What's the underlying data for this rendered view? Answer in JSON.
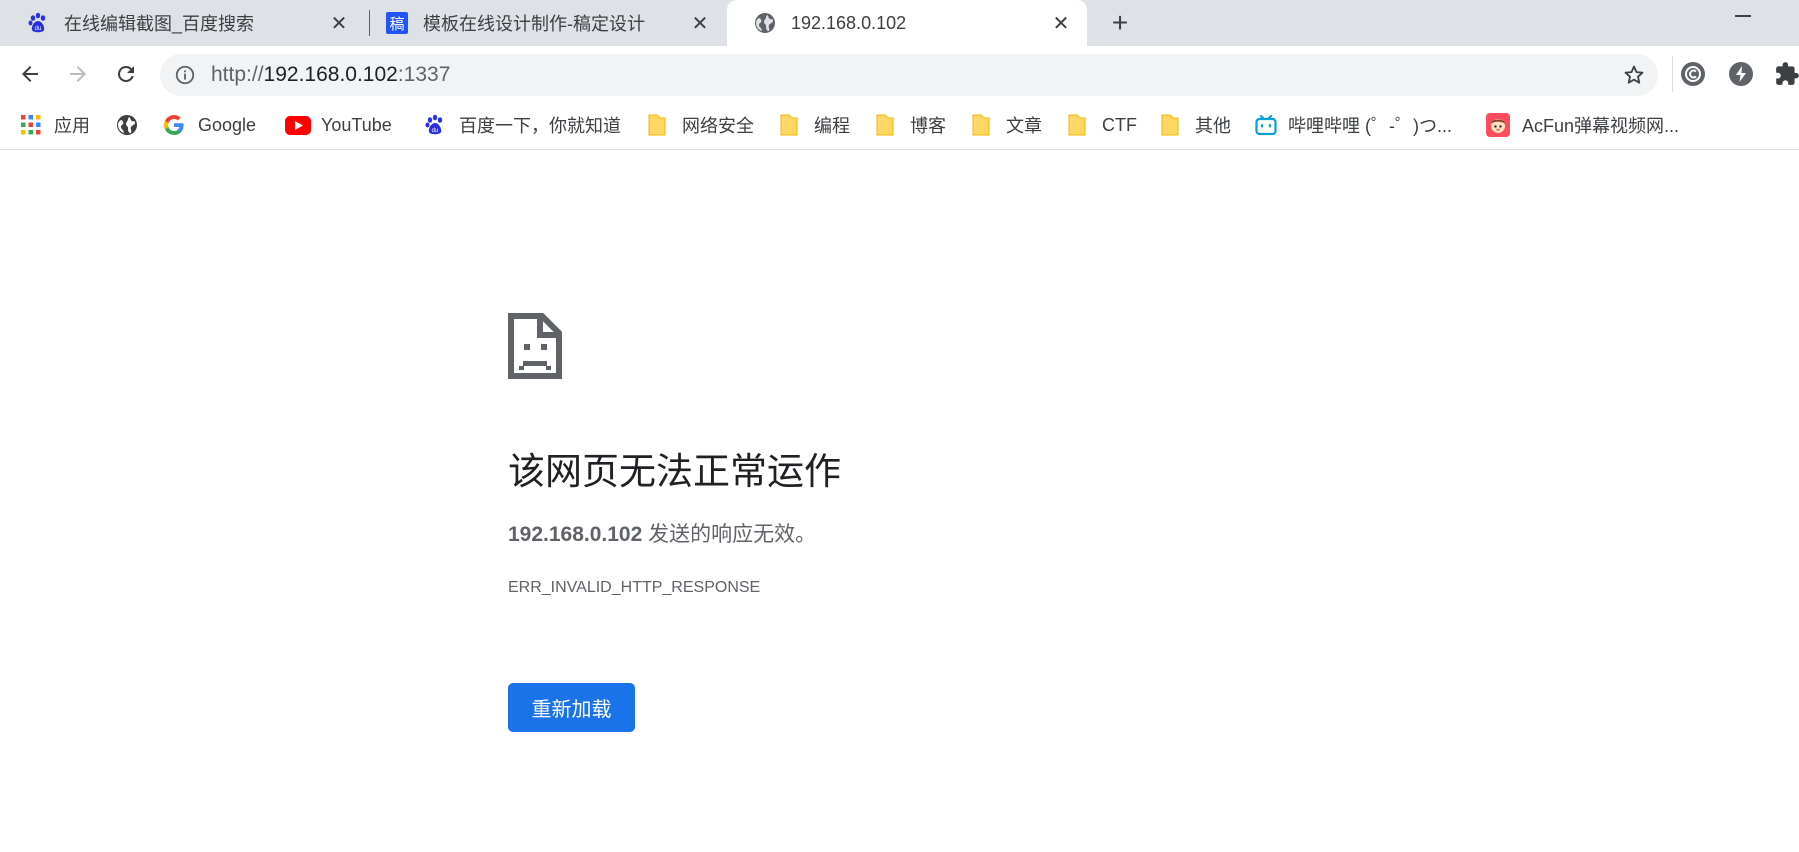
{
  "tabs": [
    {
      "title": "在线编辑截图_百度搜索",
      "icon": "baidu-paw-icon"
    },
    {
      "title": "模板在线设计制作-稿定设计",
      "icon": "gaoding-icon",
      "icon_text": "稿"
    },
    {
      "title": "192.168.0.102",
      "icon": "globe-icon",
      "active": true
    }
  ],
  "new_tab_icon": "plus-icon",
  "omnibox": {
    "scheme": "http://",
    "host": "192.168.0.102",
    "port": ":1337"
  },
  "bookmarks": [
    {
      "label": "应用",
      "icon": "apps-grid-icon"
    },
    {
      "label": "",
      "icon": "globe-icon"
    },
    {
      "label": "Google",
      "icon": "google-icon"
    },
    {
      "label": "YouTube",
      "icon": "youtube-icon"
    },
    {
      "label": "百度一下，你就知道",
      "icon": "baidu-paw-icon"
    },
    {
      "label": "网络安全",
      "icon": "folder-icon"
    },
    {
      "label": "编程",
      "icon": "folder-icon"
    },
    {
      "label": "博客",
      "icon": "folder-icon"
    },
    {
      "label": "文章",
      "icon": "folder-icon"
    },
    {
      "label": "CTF",
      "icon": "folder-icon"
    },
    {
      "label": "其他",
      "icon": "folder-icon"
    },
    {
      "label": "哔哩哔哩 (゜-゜)つ...",
      "icon": "bilibili-icon"
    },
    {
      "label": "AcFun弹幕视频网...",
      "icon": "acfun-icon"
    }
  ],
  "error": {
    "title": "该网页无法正常运作",
    "host": "192.168.0.102",
    "message": " 发送的响应无效。",
    "code": "ERR_INVALID_HTTP_RESPONSE",
    "reload_label": "重新加载"
  },
  "colors": {
    "accent": "#1a73e8",
    "tabstrip": "#dee1e6",
    "omnibox": "#f1f3f4",
    "folder": "#fdd663",
    "youtube": "#ff0000",
    "bilibili": "#00a1d6",
    "baidu": "#2932e1"
  }
}
